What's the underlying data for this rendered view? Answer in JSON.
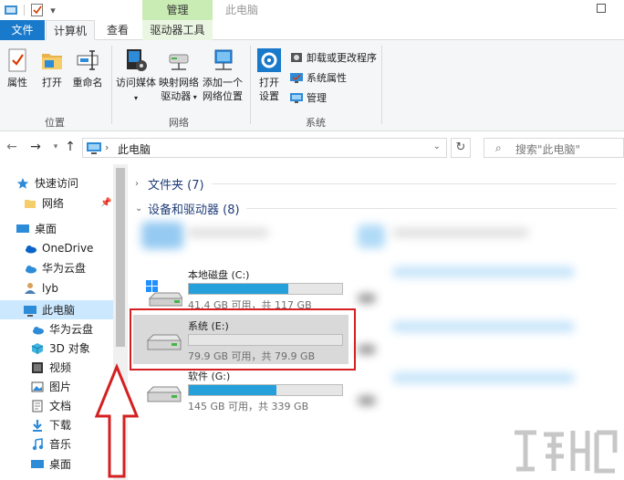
{
  "title_bar": {
    "manage_tab": "管理",
    "window_title": "此电脑"
  },
  "ribbon_tabs": {
    "file": "文件",
    "computer": "计算机",
    "view": "查看",
    "drive_tools": "驱动器工具"
  },
  "ribbon": {
    "location_group": {
      "label": "位置",
      "properties": "属性",
      "open": "打开",
      "rename": "重命名"
    },
    "network_group": {
      "label": "网络",
      "access_media": "访问媒体",
      "map_drive_line1": "映射网络",
      "map_drive_line2": "驱动器",
      "add_location_line1": "添加一个",
      "add_location_line2": "网络位置"
    },
    "system_group": {
      "label": "系统",
      "open_settings_line1": "打开",
      "open_settings_line2": "设置",
      "uninstall": "卸载或更改程序",
      "system_properties": "系统属性",
      "manage": "管理"
    }
  },
  "address_bar": {
    "path": "此电脑",
    "search_placeholder": "搜索\"此电脑\""
  },
  "nav_pane": {
    "items": [
      {
        "label": "快速访问",
        "icon": "star-icon"
      },
      {
        "label": "网络",
        "icon": "folder-icon"
      },
      {
        "label": "桌面",
        "icon": "desktop-icon"
      },
      {
        "label": "OneDrive",
        "icon": "cloud-icon"
      },
      {
        "label": "华为云盘",
        "icon": "cloud-icon"
      },
      {
        "label": "lyb",
        "icon": "user-icon"
      },
      {
        "label": "此电脑",
        "icon": "computer-icon"
      },
      {
        "label": "华为云盘",
        "icon": "cloud-icon"
      },
      {
        "label": "3D 对象",
        "icon": "cube-icon"
      },
      {
        "label": "视频",
        "icon": "video-icon"
      },
      {
        "label": "图片",
        "icon": "picture-icon"
      },
      {
        "label": "文档",
        "icon": "document-icon"
      },
      {
        "label": "下载",
        "icon": "download-icon"
      },
      {
        "label": "音乐",
        "icon": "music-icon"
      },
      {
        "label": "桌面",
        "icon": "desktop-icon"
      }
    ]
  },
  "content": {
    "folders_header": "文件夹 (7)",
    "devices_header": "设备和驱动器 (8)",
    "drives": [
      {
        "name": "本地磁盘 (C:)",
        "info": "41.4 GB 可用，共 117 GB",
        "used_fraction": 0.646
      },
      {
        "name": "系统 (E:)",
        "info": "79.9 GB 可用，共 79.9 GB",
        "used_fraction": 0.0
      },
      {
        "name": "软件 (G:)",
        "info": "145 GB 可用，共 339 GB",
        "used_fraction": 0.572
      }
    ]
  },
  "colors": {
    "accent": "#1979ca",
    "manage_tab": "#c9ecb4",
    "selection": "#cce8ff",
    "drive_bar": "#26a0da",
    "highlight_box": "#d42020"
  }
}
